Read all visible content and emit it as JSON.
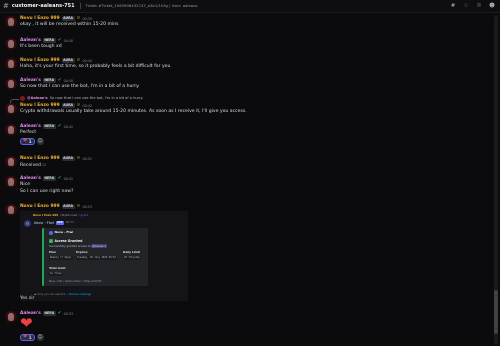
{
  "channel": {
    "name": "customer-aaleans-751",
    "topic": "Ticket #Ticket_1063906432747_a3b1/1k3g | User: aaleans",
    "toolbar_icons": [
      "threads-icon",
      "bell-icon",
      "pin-icon",
      "members-icon"
    ]
  },
  "users": {
    "novu": {
      "name": "Novu l Enzo 999",
      "tag": "AURA"
    },
    "aalean": {
      "name": "Aalean's",
      "tag": "NERU"
    }
  },
  "messages": [
    {
      "id": "m1",
      "author": "Novu l Enzo 999",
      "tag": "AURA",
      "time": "00:39",
      "text": "okay , it will be received within 15-20 mins"
    },
    {
      "id": "m2",
      "author": "Aalean's",
      "tag": "NERU",
      "time": "00:40",
      "text": "It's been tough xd"
    },
    {
      "id": "m3",
      "author": "Novu l Enzo 999",
      "tag": "AURA",
      "time": "00:40",
      "text": "Haha, it's your first time, so it probably feels a bit difficult for you"
    },
    {
      "id": "m4",
      "author": "Aalean's",
      "tag": "NERU",
      "time": "00:40",
      "text": "So now that I can use the bot, I'm in a bit of a hurry."
    },
    {
      "id": "m5",
      "reply_to": {
        "author": "@Aalean's",
        "text": "So now that I can use the bot, I'm in a bit of a hurry."
      },
      "author": "Novu l Enzo 999",
      "tag": "AURA",
      "time": "00:42",
      "text": "Crypto withdrawals usually take around 15-20 minutes. As soon as I receive it, I'll give you access."
    },
    {
      "id": "m6",
      "author": "Aalean's",
      "tag": "NERU",
      "time": "00:42",
      "text": "Perfect",
      "reactions": [
        {
          "emoji": "heart",
          "count": "1"
        }
      ]
    },
    {
      "id": "m7",
      "author": "Novu l Enzo 999",
      "tag": "AURA",
      "time": "00:52",
      "text": "Received",
      "emoji": "check-emoji"
    },
    {
      "id": "m8",
      "author": "Aalean's",
      "tag": "NERU",
      "time": "00:52",
      "text": "Nice",
      "text2": "So I can use right now?"
    },
    {
      "id": "m9",
      "author": "Novu l Enzo 999",
      "tag": "AURA",
      "time": "00:53",
      "text": "Yes sir",
      "reactions": [
        {
          "emoji": "heart",
          "count": "1"
        }
      ]
    },
    {
      "id": "m10",
      "author": "Aalean's",
      "tag": "NERU",
      "time": "00:53"
    }
  ],
  "embed": {
    "reply_author": "Novu l Enzo 999",
    "reply_text": "/ RLJ2Z used",
    "reply_command": "/ grant",
    "bot_name": "Nova - Fiwi",
    "app_tag": "APP",
    "time": "00:53",
    "author": "Nova - Fiwi",
    "title": "Access Granted",
    "description_prefix": "Successfully granted access to",
    "description_mention": "@Aalean's",
    "fields": [
      {
        "name": "Plan",
        "value": "Weekly (7 days)"
      },
      {
        "name": "Expires",
        "value": "Tuesday, 26 July 2024 00:53"
      },
      {
        "name": "Daily Limit",
        "value": "20 file/day"
      }
    ],
    "total_limit": {
      "name": "Total Limit",
      "value": "1k files"
    },
    "footer": "Nova - Fiwi • Admin Action • Today at 00:53",
    "note_prefix": "Only you can see this •",
    "note_link": "Dismiss message"
  }
}
